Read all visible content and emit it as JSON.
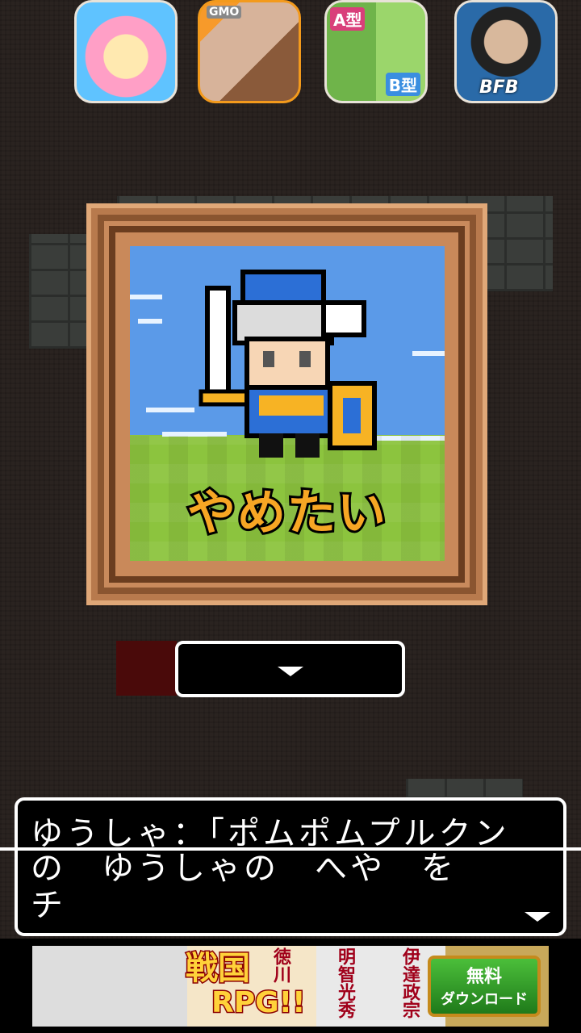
{
  "ads": {
    "icon2_label": "GMO",
    "icon3_label_a": "A型",
    "icon3_label_b": "B型",
    "icon4_label": "BFB"
  },
  "picture": {
    "title": "やめたい"
  },
  "dialog": {
    "line1": "ゆうしゃ：「ポムポムプルクン",
    "line2": "の　ゆうしゃの　へや　を",
    "line3": "チ"
  },
  "banner": {
    "title": "戦国",
    "title2": "RPG!!",
    "name1": "徳川",
    "name2": "明智光秀",
    "name3": "伊達政宗",
    "download_line1": "無料",
    "download_line2": "ダウンロード"
  }
}
